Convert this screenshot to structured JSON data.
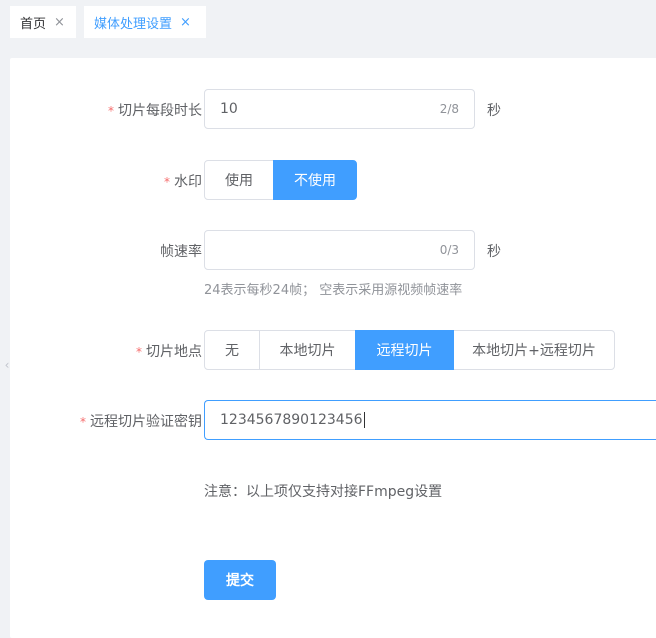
{
  "tabs": [
    {
      "label": "首页",
      "close": "×"
    },
    {
      "label": "媒体处理设置",
      "close": "×"
    }
  ],
  "form": {
    "segment_duration": {
      "required": "*",
      "label": "切片每段时长",
      "value": "10",
      "count": "2/8",
      "unit": "秒"
    },
    "watermark": {
      "required": "*",
      "label": "水印",
      "options": [
        "使用",
        "不使用"
      ],
      "selected": "不使用"
    },
    "frame_rate": {
      "label": "帧速率",
      "value": "",
      "count": "0/3",
      "unit": "秒",
      "hint": "24表示每秒24帧； 空表示采用源视频帧速率"
    },
    "slice_location": {
      "required": "*",
      "label": "切片地点",
      "options": [
        "无",
        "本地切片",
        "远程切片",
        "本地切片+远程切片"
      ],
      "selected": "远程切片"
    },
    "remote_key": {
      "required": "*",
      "label": "远程切片验证密钥",
      "value": "1234567890123456"
    },
    "note": "注意：以上项仅支持对接FFmpeg设置",
    "submit_label": "提交"
  },
  "edge_arrow_icon": "chevron-left-icon",
  "colors": {
    "accent": "#409eff",
    "required": "#f56c6c"
  }
}
